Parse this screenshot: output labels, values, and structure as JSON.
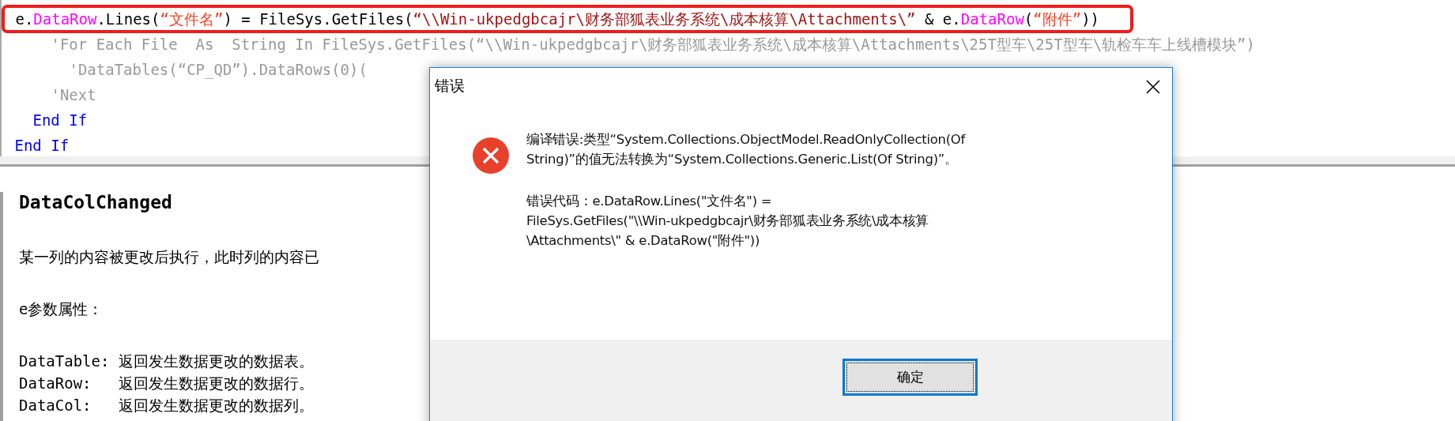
{
  "code_editor": {
    "lines": [
      {
        "highlighted": true,
        "tokens": [
          {
            "text": "e.",
            "color": "#000000"
          },
          {
            "text": "DataRow",
            "color": "#ff00ff"
          },
          {
            "text": ".Lines(",
            "color": "#000000"
          },
          {
            "text": "“文件名”",
            "color": "#ff3b1f"
          },
          {
            "text": ") = FileSys.GetFiles(",
            "color": "#000000"
          },
          {
            "text": "“\\\\Win-ukpedgbcajr\\财务部狐表业务系统\\成本核算\\Attachments\\”",
            "color": "#a31515"
          },
          {
            "text": " & e.",
            "color": "#000000"
          },
          {
            "text": "DataRow",
            "color": "#ff00ff"
          },
          {
            "text": "(",
            "color": "#000000"
          },
          {
            "text": "“附件”",
            "color": "#ff3b1f"
          },
          {
            "text": "))",
            "color": "#000000"
          }
        ]
      },
      {
        "children": [
          {
            "children": [
              {
                "highlighted": false,
                "tokens": [
                  {
                    "text": "'For Each File  As  String In FileSys.GetFiles(“\\\\Win-ukpedgbcajr\\财务部狐表业务系统\\成本核算\\Attachments\\25T型车\\25T型车\\轨检车车上线槽模块”)",
                    "color": "#999999"
                  }
                ]
              },
              {
                "children": [
                  {
                    "highlighted": false,
                    "tokens": [
                      {
                        "text": "'DataTables(“CP_QD”).DataRows(0)(",
                        "color": "#999999"
                      }
                    ]
                  }
                ]
              },
              {
                "highlighted": false,
                "tokens": [
                  {
                    "text": "'Next",
                    "color": "#999999"
                  }
                ]
              }
            ]
          },
          {
            "highlighted": false,
            "tokens": [
              {
                "text": "End If",
                "color": "#0000ff"
              }
            ]
          }
        ]
      },
      {
        "highlighted": false,
        "tokens": [
          {
            "text": "End If",
            "color": "#0000ff"
          }
        ]
      }
    ]
  },
  "help_panel": {
    "title": "DataColChanged",
    "description": "某一列的内容被更改后执行，此时列的内容已",
    "section": "e参数属性：",
    "properties": [
      {
        "name": "DataTable:",
        "text": "返回发生数据更改的数据表。"
      },
      {
        "name": "DataRow:",
        "text": "返回发生数据更改的数据行。"
      },
      {
        "name": "DataCol:",
        "text": "返回发生数据更改的数据列。"
      }
    ]
  },
  "dialog": {
    "title": "错误",
    "message_lines": [
      "编译错误:类型“System.Collections.ObjectModel.ReadOnlyCollection(Of",
      "String)”的值无法转换为“System.Collections.Generic.List(Of String)”。"
    ],
    "code_lines": [
      "错误代码：e.DataRow.Lines(\"文件名\") =",
      "FileSys.GetFiles(\"\\\\Win-ukpedgbcajr\\财务部狐表业务系统\\成本核算",
      "\\Attachments\\\" & e.DataRow(\"附件\"))"
    ],
    "buttons": [
      {
        "label": "确定",
        "focused": true
      }
    ]
  }
}
